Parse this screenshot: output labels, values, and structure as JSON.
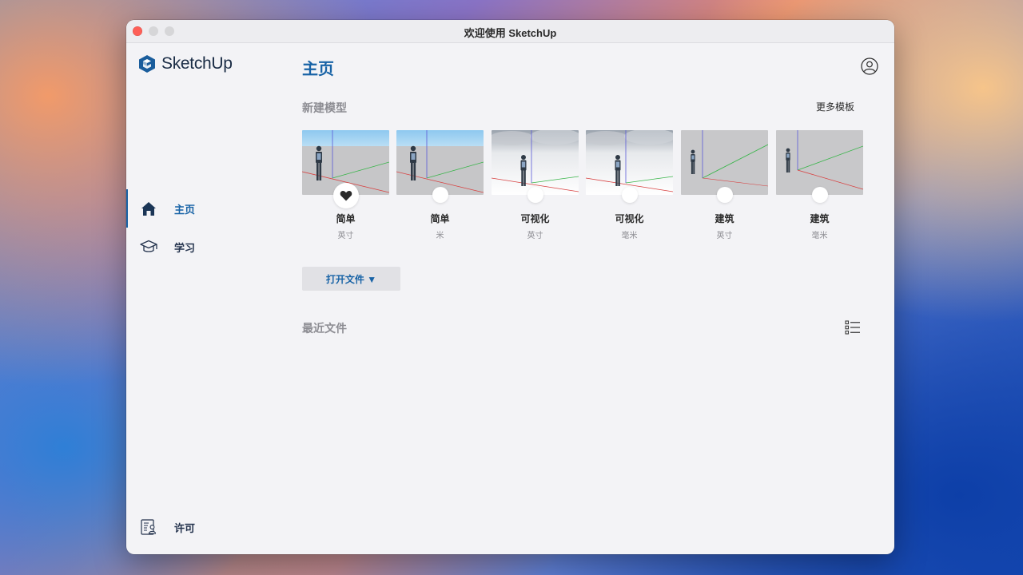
{
  "window": {
    "title": "欢迎使用 SketchUp"
  },
  "brand": {
    "name": "SketchUp"
  },
  "sidebar": {
    "items": [
      {
        "label": "主页",
        "icon": "home-icon",
        "active": true
      },
      {
        "label": "学习",
        "icon": "graduation-cap-icon",
        "active": false
      }
    ],
    "footer": {
      "label": "许可",
      "icon": "license-icon"
    }
  },
  "main": {
    "title": "主页",
    "new_model_label": "新建模型",
    "more_templates_label": "更多模板",
    "templates": [
      {
        "name": "简单",
        "unit": "英寸",
        "style": "simple",
        "favorite": true
      },
      {
        "name": "简单",
        "unit": "米",
        "style": "simple",
        "favorite": false
      },
      {
        "name": "可视化",
        "unit": "英寸",
        "style": "visual",
        "favorite": false
      },
      {
        "name": "可视化",
        "unit": "毫米",
        "style": "visual",
        "favorite": false
      },
      {
        "name": "建筑",
        "unit": "英寸",
        "style": "architecture",
        "favorite": false
      },
      {
        "name": "建筑",
        "unit": "毫米",
        "style": "architecture",
        "favorite": false
      }
    ],
    "open_file_label": "打开文件 ▼",
    "recent_files_label": "最近文件"
  },
  "colors": {
    "accent": "#1863a6",
    "text": "#24334d",
    "muted": "#8d8d93",
    "close": "#fe5f57"
  }
}
